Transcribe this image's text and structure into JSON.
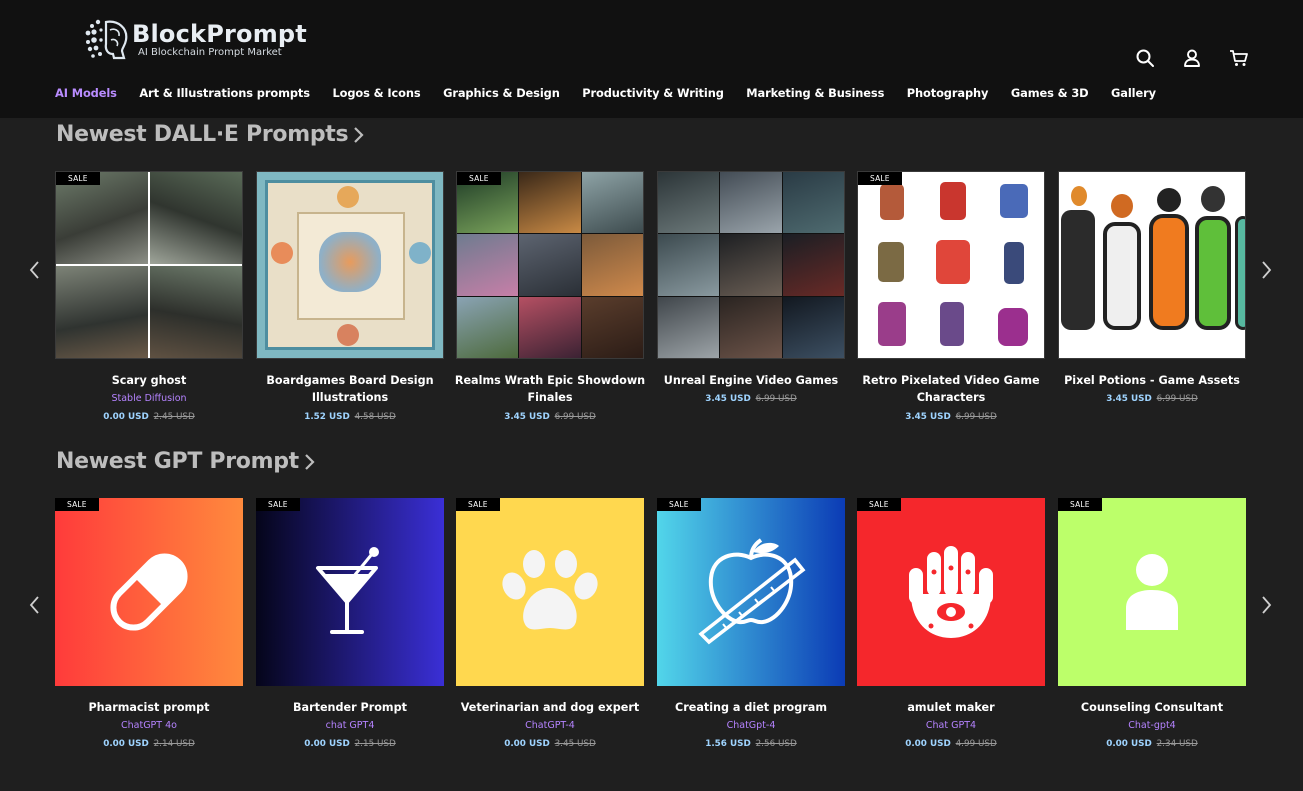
{
  "brand": {
    "name": "BlockPrompt",
    "tagline": "AI Blockchain Prompt Market"
  },
  "header_icons": [
    "search-icon",
    "user-icon",
    "cart-icon"
  ],
  "nav": [
    {
      "label": "AI Models",
      "active": true
    },
    {
      "label": "Art & Illustrations prompts",
      "active": false
    },
    {
      "label": "Logos & Icons",
      "active": false
    },
    {
      "label": "Graphics & Design",
      "active": false
    },
    {
      "label": "Productivity & Writing",
      "active": false
    },
    {
      "label": "Marketing & Business",
      "active": false
    },
    {
      "label": "Photography",
      "active": false
    },
    {
      "label": "Games & 3D",
      "active": false
    },
    {
      "label": "Gallery",
      "active": false
    }
  ],
  "sections": [
    {
      "title": "Newest DALL·E Prompts",
      "cards": [
        {
          "title": "Scary ghost",
          "model": "Stable Diffusion",
          "price": "0.00 USD",
          "old_price": "2.45 USD",
          "sale": true,
          "sale_label": "SALE"
        },
        {
          "title": "Boardgames Board Design Illustrations",
          "model": "",
          "price": "1.52 USD",
          "old_price": "4.58 USD",
          "sale": false
        },
        {
          "title": "Realms Wrath Epic Showdown Finales",
          "model": "",
          "price": "3.45 USD",
          "old_price": "6.99 USD",
          "sale": true,
          "sale_label": "SALE"
        },
        {
          "title": "Unreal Engine Video Games",
          "model": "",
          "price": "3.45 USD",
          "old_price": "6.99 USD",
          "sale": false
        },
        {
          "title": "Retro Pixelated Video Game Characters",
          "model": "",
          "price": "3.45 USD",
          "old_price": "6.99 USD",
          "sale": true,
          "sale_label": "SALE"
        },
        {
          "title": "Pixel Potions - Game Assets",
          "model": "",
          "price": "3.45 USD",
          "old_price": "6.99 USD",
          "sale": false
        }
      ]
    },
    {
      "title": "Newest GPT Prompt",
      "cards": [
        {
          "title": "Pharmacist prompt",
          "model": "ChatGPT 4o",
          "price": "0.00 USD",
          "old_price": "2.14 USD",
          "sale": true,
          "sale_label": "SALE",
          "icon": "pill-icon",
          "bg": [
            "#ff3b3b",
            "#ff8a3d"
          ]
        },
        {
          "title": "Bartender Prompt",
          "model": "chat GPT4",
          "price": "0.00 USD",
          "old_price": "2.15 USD",
          "sale": true,
          "sale_label": "SALE",
          "icon": "cocktail-icon",
          "bg": [
            "#05051a",
            "#3a2fd6"
          ]
        },
        {
          "title": "Veterinarian and dog expert",
          "model": "ChatGPT-4",
          "price": "0.00 USD",
          "old_price": "3.45 USD",
          "sale": true,
          "sale_label": "SALE",
          "icon": "paw-icon",
          "bg": [
            "#ffd84f",
            "#ffd84f"
          ]
        },
        {
          "title": "Creating a diet program",
          "model": "ChatGpt-4",
          "price": "1.56 USD",
          "old_price": "2.56 USD",
          "sale": true,
          "sale_label": "SALE",
          "icon": "apple-measure-icon",
          "bg": [
            "#52d6ea",
            "#0b3bb5"
          ]
        },
        {
          "title": "amulet maker",
          "model": "Chat GPT4",
          "price": "0.00 USD",
          "old_price": "4.99 USD",
          "sale": true,
          "sale_label": "SALE",
          "icon": "hamsa-icon",
          "bg": [
            "#f5272c",
            "#f5272c"
          ]
        },
        {
          "title": "Counseling Consultant",
          "model": "Chat-gpt4",
          "price": "0.00 USD",
          "old_price": "2.34 USD",
          "sale": true,
          "sale_label": "SALE",
          "icon": "person-icon",
          "bg": [
            "#bcff6a",
            "#bcff6a"
          ]
        }
      ]
    }
  ]
}
